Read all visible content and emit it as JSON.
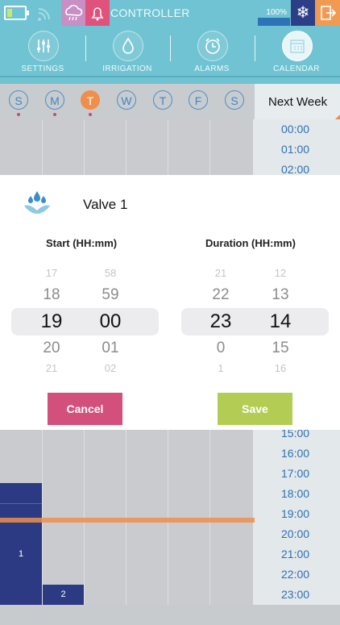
{
  "status_bar": {
    "title": "CONTROLLER",
    "battery_level": "100%",
    "icons": [
      "battery-icon",
      "wifi-icon",
      "cloud-rain-icon",
      "bell-icon",
      "snowflake-icon",
      "exit-icon"
    ]
  },
  "nav": {
    "items": [
      {
        "label": "SETTINGS",
        "icon": "sliders-icon"
      },
      {
        "label": "IRRIGATION",
        "icon": "water-drop-icon"
      },
      {
        "label": "ALARMS",
        "icon": "alarm-clock-icon"
      },
      {
        "label": "CALENDAR",
        "icon": "calendar-icon",
        "active": true
      }
    ]
  },
  "days": {
    "items": [
      {
        "label": "S",
        "dot": true
      },
      {
        "label": "M",
        "dot": true
      },
      {
        "label": "T",
        "dot": true,
        "active": true
      },
      {
        "label": "W",
        "dot": false
      },
      {
        "label": "T",
        "dot": false
      },
      {
        "label": "F",
        "dot": false
      },
      {
        "label": "S",
        "dot": false
      }
    ],
    "next_week": "Next Week"
  },
  "timeline": {
    "times_top": [
      "00:00",
      "01:00",
      "02:00"
    ],
    "times_bottom": [
      "15:00",
      "16:00",
      "17:00",
      "18:00",
      "19:00",
      "20:00",
      "21:00",
      "22:00",
      "23:00"
    ]
  },
  "blocks": [
    {
      "label": "1"
    },
    {
      "label": "2"
    }
  ],
  "modal": {
    "valve_label": "Valve 1",
    "start_title": "Start (HH:mm)",
    "duration_title": "Duration (HH:mm)",
    "start_hours": [
      "17",
      "18",
      "19",
      "20",
      "21"
    ],
    "start_minutes": [
      "58",
      "59",
      "00",
      "01",
      "02"
    ],
    "duration_hours": [
      "21",
      "22",
      "23",
      "0",
      "1"
    ],
    "duration_minutes": [
      "12",
      "13",
      "14",
      "15",
      "16"
    ],
    "cancel_label": "Cancel",
    "save_label": "Save"
  },
  "colors": {
    "header": "#6fc3d2",
    "accent_orange": "#ef8f4b",
    "cancel": "#d34f7c",
    "save": "#b3cd54",
    "block": "#2c3a83"
  }
}
